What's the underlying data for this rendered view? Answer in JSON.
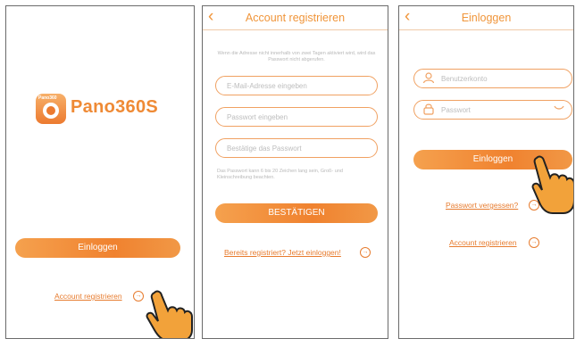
{
  "screen1": {
    "logo_small": "Pano360",
    "logo_text": "Pano360S",
    "login_button": "Einloggen",
    "register_link": "Account registrieren"
  },
  "screen2": {
    "back": "‹",
    "title": "Account registrieren",
    "note_top": "Wenn die Adresse nicht innerhalb von zwei Tagen aktiviert wird, wird das Passwort nicht abgerufen.",
    "email_placeholder": "E-Mail-Adresse eingeben",
    "password_placeholder": "Passwort eingeben",
    "confirm_placeholder": "Bestätige das Passwort",
    "note_bottom": "Das Passwort kann 6 bis 20 Zeichen lang sein, Groß- und Kleinschreibung beachten.",
    "confirm_button": "BESTÄTIGEN",
    "login_link": "Bereits registriert? Jetzt einloggen!"
  },
  "screen3": {
    "back": "‹",
    "title": "Einloggen",
    "account_placeholder": "Benutzerkonto",
    "password_placeholder": "Passwort",
    "login_button": "Einloggen",
    "forgot_link": "Passwort vergessen?",
    "register_link": "Account registrieren"
  },
  "colors": {
    "accent": "#f0953a",
    "border": "#f0a162",
    "hand": "#f2a23a"
  },
  "icons": [
    "app-logo-icon",
    "back-icon",
    "user-icon",
    "lock-icon",
    "eye-icon",
    "arrow-right-circle-icon",
    "pointing-hand-icon"
  ]
}
